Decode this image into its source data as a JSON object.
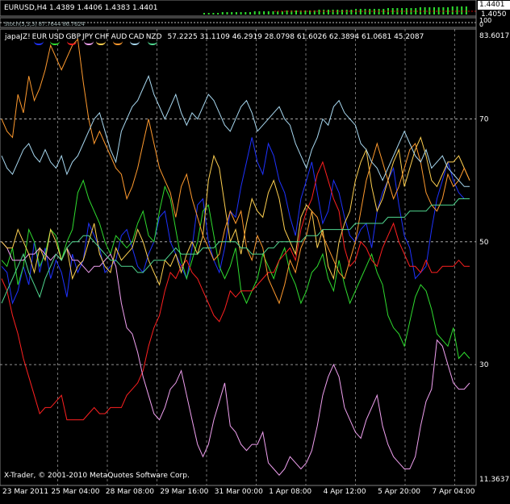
{
  "top_panel": {
    "title": "EURUSD,H4  1.4389 1.4406 1.4383 1.4401",
    "price_labels": [
      "1.4401",
      "1.4050"
    ],
    "current_price": "1.4401"
  },
  "sub_panel": {
    "title": "Stoch(5,3,3) 87.7644 86.7624",
    "scale_labels": [
      "100",
      "0"
    ]
  },
  "indicator": {
    "name": "japaJZ!",
    "values_text": "57.2225 31.1109 46.2919 28.0798 61.6026 62.3894 61.0681 45.2087",
    "copyright": "X-Trader, © 2001-2010 MetaQuotes Software Corp."
  },
  "colors": {
    "background": "#000000",
    "grid": "#c0c0c0",
    "axis_text": "#ffffff",
    "EUR": "#1e32ff",
    "USD": "#2fdc2f",
    "GBP": "#ff2020",
    "JPY": "#f0a0f0",
    "CHF": "#ffd050",
    "AUD": "#ff9a2e",
    "CAD": "#a8d8f0",
    "NZD": "#50d890"
  },
  "chart_data": {
    "type": "line",
    "title": "japaJZ!",
    "ylim": [
      11.3637,
      83.6017
    ],
    "y_ticks": [
      83.6017,
      70,
      50,
      30,
      11.3637
    ],
    "y_tick_labels": [
      "83.6017",
      "70",
      "50",
      "30",
      "11.3637"
    ],
    "x_tick_labels": [
      "23 Mar 2011",
      "25 Mar 04:00",
      "28 Mar 08:00",
      "29 Mar 16:00",
      "31 Mar 00:00",
      "1 Apr 08:00",
      "4 Apr 12:00",
      "5 Apr 20:00",
      "7 Apr 04:00"
    ],
    "x_tick_index": [
      0,
      10,
      20,
      30,
      40,
      50,
      60,
      70,
      80
    ],
    "grid": true,
    "legend_placement": "top-left",
    "series": [
      {
        "name": "EUR",
        "values": [
          46,
          45,
          40,
          42,
          46,
          43,
          50,
          45,
          49,
          44,
          47,
          45,
          41,
          48,
          45,
          47,
          53,
          51,
          49,
          45,
          46,
          47,
          51,
          52,
          49,
          46,
          45,
          48,
          50,
          54,
          55,
          50,
          48,
          46,
          44,
          49,
          56,
          57,
          50,
          47,
          45,
          49,
          55,
          54,
          59,
          63,
          67,
          63,
          61,
          66,
          64,
          60,
          58,
          54,
          51,
          57,
          60,
          63,
          58,
          53,
          55,
          60,
          58,
          54,
          51,
          50,
          52,
          53,
          49,
          55,
          58,
          60,
          62,
          56,
          51,
          49,
          44,
          45,
          46,
          52,
          57,
          60,
          63,
          60,
          58,
          57,
          57
        ]
      },
      {
        "name": "USD",
        "values": [
          47,
          46,
          49,
          43,
          46,
          52,
          50,
          46,
          48,
          52,
          51,
          47,
          50,
          52,
          58,
          60,
          57,
          55,
          53,
          50,
          48,
          51,
          50,
          49,
          50,
          53,
          55,
          51,
          50,
          55,
          59,
          57,
          52,
          47,
          44,
          47,
          50,
          55,
          56,
          51,
          46,
          44,
          46,
          49,
          42,
          40,
          42,
          44,
          48,
          46,
          44,
          47,
          49,
          45,
          43,
          40,
          42,
          45,
          46,
          48,
          44,
          42,
          47,
          43,
          40,
          42,
          44,
          46,
          48,
          45,
          43,
          38,
          36,
          35,
          33,
          37,
          41,
          43,
          42,
          39,
          35,
          34,
          33,
          36,
          31,
          32,
          31
        ]
      },
      {
        "name": "GBP",
        "values": [
          44,
          42,
          38,
          35,
          31,
          28,
          25,
          22,
          23,
          23,
          24,
          25,
          21,
          21,
          21,
          21,
          22,
          23,
          22,
          22,
          23,
          23,
          23,
          25,
          26,
          27,
          29,
          33,
          36,
          38,
          42,
          45,
          44,
          46,
          47,
          45,
          44,
          42,
          40,
          38,
          37,
          39,
          42,
          41,
          42,
          42,
          42,
          43,
          44,
          45,
          45,
          47,
          48,
          49,
          47,
          52,
          55,
          57,
          61,
          63,
          60,
          57,
          55,
          49,
          46,
          47,
          50,
          49,
          47,
          46,
          49,
          51,
          53,
          50,
          48,
          46,
          46,
          45,
          47,
          45,
          45,
          46,
          46,
          46,
          47,
          46,
          46
        ]
      },
      {
        "name": "JPY",
        "values": [
          50,
          49,
          47,
          47,
          47,
          48,
          48,
          49,
          48,
          47,
          48,
          47,
          49,
          47,
          47,
          46,
          45,
          46,
          46,
          47,
          48,
          46,
          40,
          36,
          35,
          32,
          28,
          25,
          22,
          21,
          23,
          26,
          27,
          29,
          25,
          21,
          17,
          15,
          17,
          21,
          24,
          27,
          20,
          19,
          17,
          16,
          17,
          17,
          19,
          14,
          13,
          12,
          13,
          15,
          14,
          13,
          14,
          16,
          20,
          25,
          28,
          30,
          28,
          23,
          21,
          19,
          18,
          21,
          23,
          25,
          20,
          17,
          15,
          14,
          13,
          13,
          15,
          20,
          24,
          26,
          34,
          33,
          30,
          27,
          26,
          26,
          27
        ]
      },
      {
        "name": "CHF",
        "values": [
          50,
          49,
          49,
          52,
          50,
          48,
          45,
          49,
          47,
          52,
          50,
          47,
          49,
          44,
          46,
          47,
          50,
          53,
          48,
          46,
          45,
          49,
          47,
          48,
          49,
          52,
          50,
          47,
          45,
          43,
          47,
          46,
          48,
          45,
          48,
          50,
          48,
          51,
          60,
          64,
          62,
          56,
          50,
          52,
          48,
          53,
          57,
          55,
          54,
          58,
          60,
          57,
          52,
          50,
          48,
          54,
          56,
          55,
          49,
          52,
          46,
          44,
          50,
          53,
          55,
          60,
          63,
          65,
          59,
          55,
          57,
          60,
          63,
          65,
          59,
          62,
          65,
          67,
          64,
          60,
          59,
          61,
          63,
          63,
          64,
          62,
          60
        ]
      },
      {
        "name": "AUD",
        "values": [
          70,
          68,
          67,
          74,
          71,
          77,
          73,
          75,
          78,
          82,
          80,
          78,
          80,
          82,
          83,
          76,
          70,
          66,
          68,
          66,
          64,
          62,
          61,
          57,
          59,
          62,
          66,
          70,
          66,
          62,
          60,
          58,
          54,
          59,
          61,
          57,
          54,
          51,
          49,
          47,
          48,
          52,
          55,
          53,
          55,
          49,
          47,
          51,
          49,
          44,
          42,
          40,
          43,
          47,
          45,
          49,
          51,
          55,
          54,
          51,
          49,
          47,
          45,
          44,
          47,
          50,
          55,
          60,
          63,
          66,
          63,
          60,
          57,
          59,
          62,
          65,
          66,
          63,
          58,
          56,
          55,
          57,
          61,
          59,
          60,
          62,
          60
        ]
      },
      {
        "name": "CAD",
        "values": [
          64,
          62,
          61,
          63,
          65,
          66,
          64,
          63,
          65,
          63,
          62,
          64,
          61,
          63,
          64,
          66,
          68,
          70,
          71,
          68,
          65,
          63,
          68,
          70,
          72,
          73,
          75,
          77,
          74,
          72,
          70,
          72,
          74,
          71,
          69,
          71,
          70,
          72,
          74,
          73,
          71,
          69,
          68,
          70,
          72,
          73,
          71,
          68,
          69,
          70,
          71,
          72,
          70,
          69,
          66,
          64,
          62,
          65,
          67,
          70,
          69,
          72,
          73,
          71,
          70,
          69,
          66,
          65,
          63,
          62,
          60,
          62,
          64,
          66,
          68,
          66,
          64,
          63,
          65,
          62,
          63,
          64,
          62,
          61,
          60,
          59,
          59
        ]
      },
      {
        "name": "NZD",
        "values": [
          40,
          42,
          44,
          46,
          48,
          45,
          43,
          41,
          44,
          46,
          48,
          47,
          49,
          50,
          50,
          51,
          51,
          50,
          49,
          48,
          47,
          47,
          46,
          46,
          46,
          45,
          45,
          46,
          47,
          47,
          47,
          48,
          49,
          48,
          48,
          48,
          48,
          49,
          49,
          49,
          50,
          50,
          50,
          50,
          49,
          49,
          48,
          48,
          48,
          49,
          49,
          50,
          50,
          50,
          50,
          50,
          51,
          51,
          51,
          52,
          52,
          52,
          52,
          52,
          52,
          53,
          53,
          53,
          53,
          53,
          53,
          54,
          54,
          54,
          54,
          55,
          55,
          55,
          55,
          56,
          56,
          56,
          56,
          56,
          57,
          57,
          57
        ]
      }
    ]
  }
}
